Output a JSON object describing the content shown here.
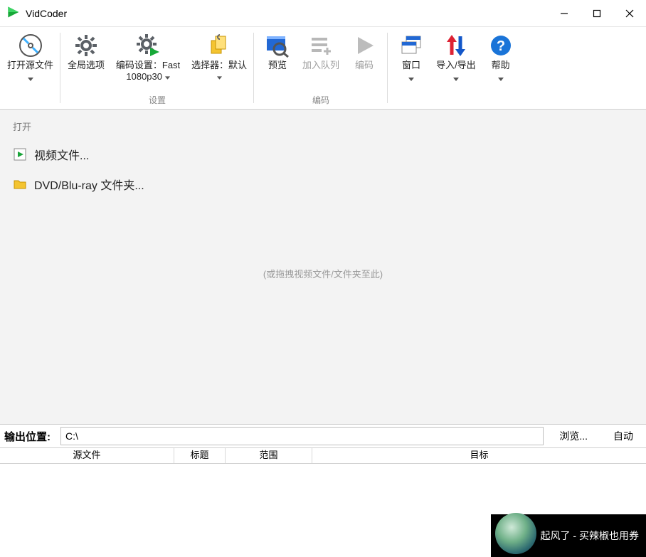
{
  "title": "VidCoder",
  "ribbon": {
    "open_source": "打开源文件",
    "global_options": "全局选项",
    "encoding_settings_l1": "编码设置：Fast",
    "encoding_settings_l2": "1080p30",
    "picker": "选择器：默认",
    "preview": "预览",
    "add_queue": "加入队列",
    "encode": "编码",
    "window": "窗口",
    "import_export": "导入/导出",
    "help": "帮助",
    "group_settings": "设置",
    "group_encode": "编码"
  },
  "open": {
    "header": "打开",
    "video_file": "视频文件...",
    "dvd_folder": "DVD/Blu-ray 文件夹...",
    "drop_hint": "(或拖拽视频文件/文件夹至此)"
  },
  "output": {
    "label": "输出位置:",
    "path": "C:\\",
    "browse": "浏览...",
    "auto": "自动"
  },
  "table": {
    "source": "源文件",
    "title_col": "标题",
    "range": "范围",
    "target": "目标"
  },
  "notif": {
    "text": "起风了 - 买辣椒也用券"
  }
}
